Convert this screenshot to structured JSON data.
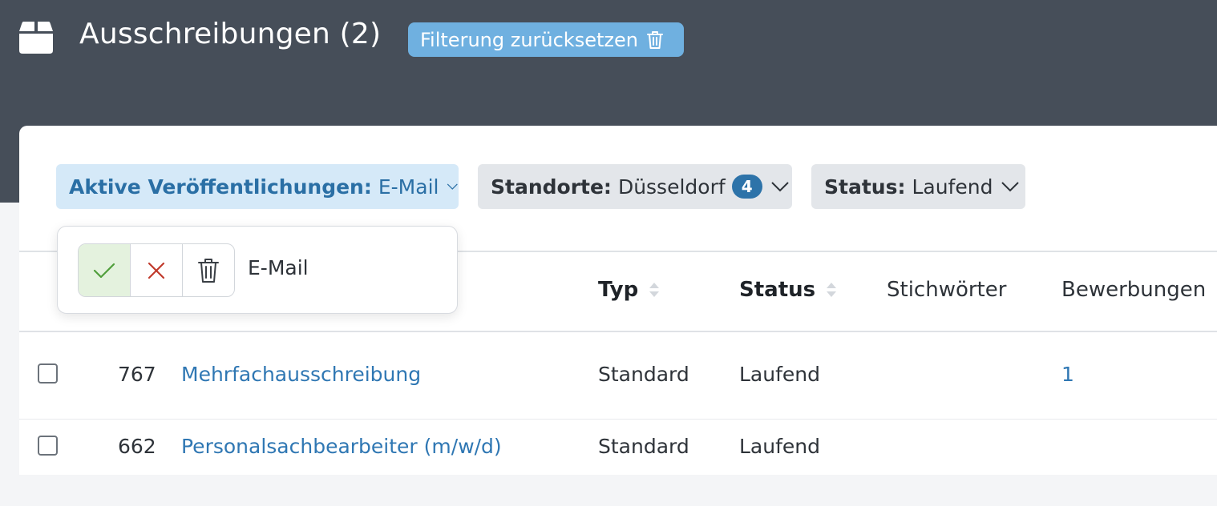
{
  "header": {
    "title": "Ausschreibungen (2)",
    "reset_label": "Filterung zurücksetzen",
    "colors": {
      "topbar": "#464e59",
      "reset_bg": "#6fb0e0"
    }
  },
  "filters": [
    {
      "label": "Aktive Veröffentlichungen:",
      "value": "E-Mail",
      "active": true
    },
    {
      "label": "Standorte:",
      "value": "Düsseldorf",
      "badge": "4"
    },
    {
      "label": "Status:",
      "value": "Laufend"
    }
  ],
  "popover": {
    "option_label": "E-Mail",
    "buttons": [
      "check-icon",
      "x-icon",
      "trash-icon"
    ]
  },
  "table": {
    "columns": [
      "Typ",
      "Status",
      "Stichwörter",
      "Bewerbungen"
    ],
    "rows": [
      {
        "id": "767",
        "title": "Mehrfachausschreibung",
        "typ": "Standard",
        "status": "Laufend",
        "stichwoerter": "",
        "bewerbungen": "1"
      },
      {
        "id": "662",
        "title": "Personalsachbearbeiter (m/w/d)",
        "typ": "Standard",
        "status": "Laufend",
        "stichwoerter": "",
        "bewerbungen": ""
      }
    ]
  }
}
